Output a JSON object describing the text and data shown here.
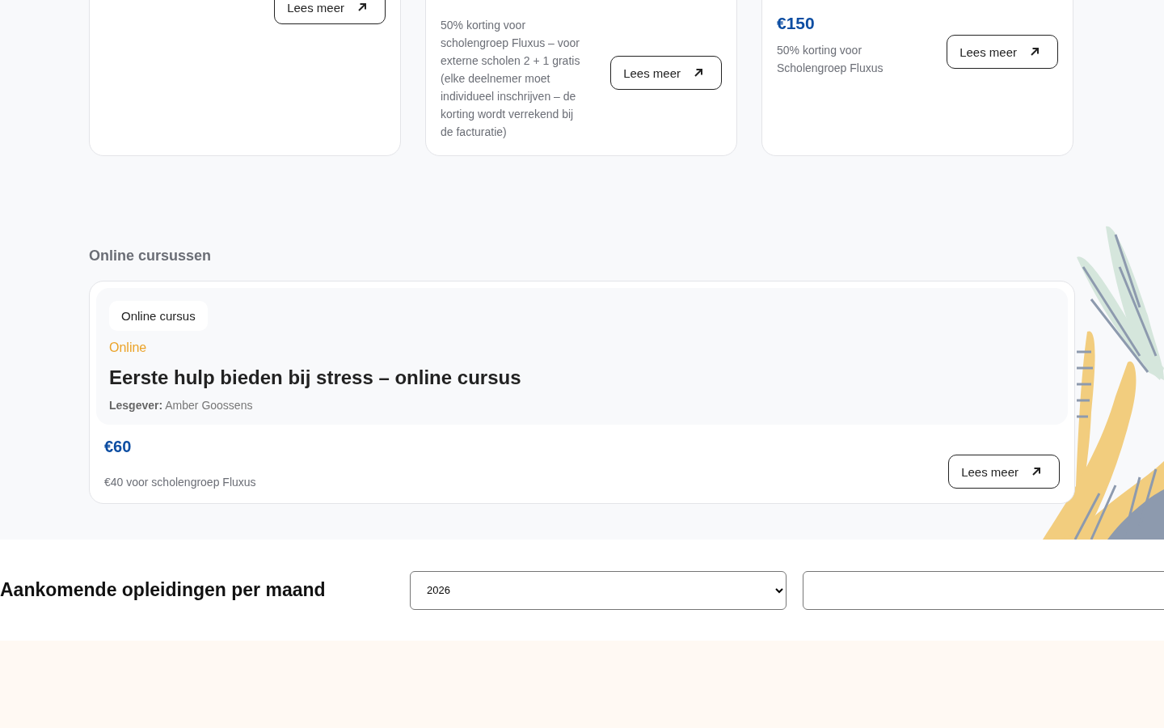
{
  "offer_cards": [
    {
      "button": "Lees meer"
    },
    {
      "description": "50% korting voor scholengroep Fluxus – voor externe scholen 2 + 1 gratis (elke deelnemer moet individueel inschrijven – de korting wordt verrekend bij de facturatie)",
      "button": "Lees meer"
    },
    {
      "price": "€150",
      "description": "50% korting voor Scholengroep Fluxus",
      "button": "Lees meer"
    }
  ],
  "online_section": {
    "heading": "Online cursussen",
    "course": {
      "tag": "Online cursus",
      "mode": "Online",
      "title": "Eerste hulp bieden bij stress – online cursus",
      "teacher": "**Lesgever:** Amber Goossens",
      "price": "€60",
      "note": "€40 voor scholengroep Fluxus",
      "button": "Lees meer"
    }
  },
  "monthly_filter": {
    "heading": "Aankomende opleidingen per maand",
    "year_select": {
      "value": "2026"
    }
  }
}
